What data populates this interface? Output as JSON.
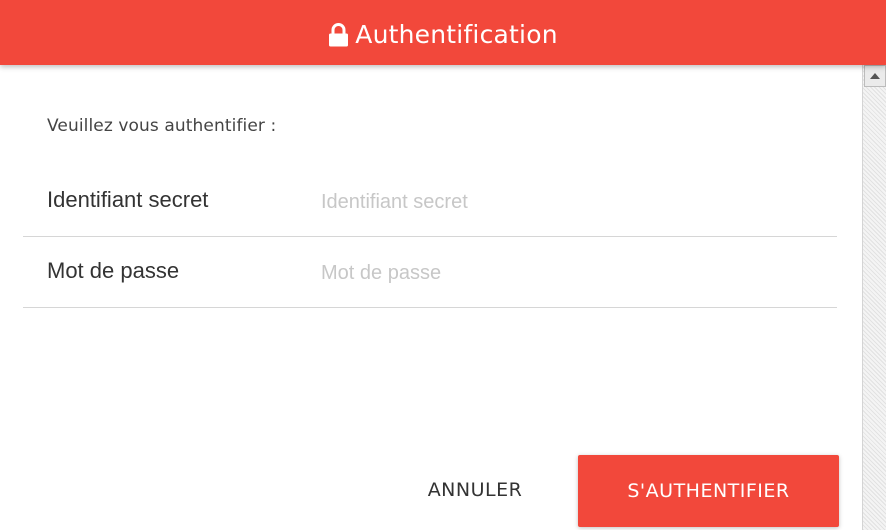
{
  "header": {
    "icon": "lock-icon",
    "title": "Authentification",
    "background_color": "#f2483b"
  },
  "form": {
    "intro": "Veuillez vous authentifier :",
    "fields": [
      {
        "label": "Identifiant secret",
        "placeholder": "Identifiant secret",
        "value": ""
      },
      {
        "label": "Mot de passe",
        "placeholder": "Mot de passe",
        "value": ""
      }
    ]
  },
  "actions": {
    "cancel_label": "ANNULER",
    "submit_label": "S'AUTHENTIFIER"
  },
  "scrollbar": {
    "up_icon": "arrow-up-icon"
  }
}
